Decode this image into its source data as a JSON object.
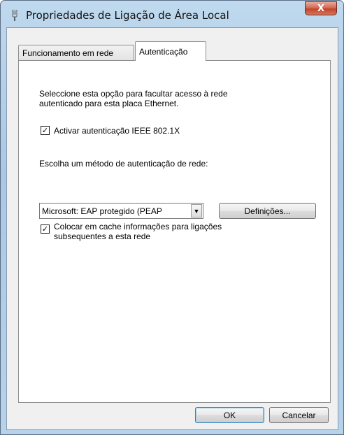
{
  "window": {
    "title": "Propriedades de Ligação de Área Local",
    "close_glyph": "X"
  },
  "tabs": [
    {
      "label": "Funcionamento em rede",
      "active": false
    },
    {
      "label": "Autenticação",
      "active": true
    }
  ],
  "auth": {
    "description_line1": "Seleccione esta opção para facultar acesso à rede",
    "description_line2": "autenticado para esta placa Ethernet.",
    "enable_checkbox_label": "Activar autenticação IEEE 802.1X",
    "enable_checked": true,
    "method_label": "Escolha um método de autenticação de rede:",
    "method_selected": "Microsoft: EAP protegido (PEAP",
    "settings_button": "Definições...",
    "cache_label_line1": "Colocar em cache informações para ligações",
    "cache_label_line2": "subsequentes a esta rede",
    "cache_checked": true,
    "check_glyph": "✓"
  },
  "footer": {
    "ok_label": "OK",
    "cancel_label": "Cancelar"
  },
  "icons": {
    "title_icon": "network-adapter-icon",
    "combo_arrow": "chevron-down-icon"
  }
}
